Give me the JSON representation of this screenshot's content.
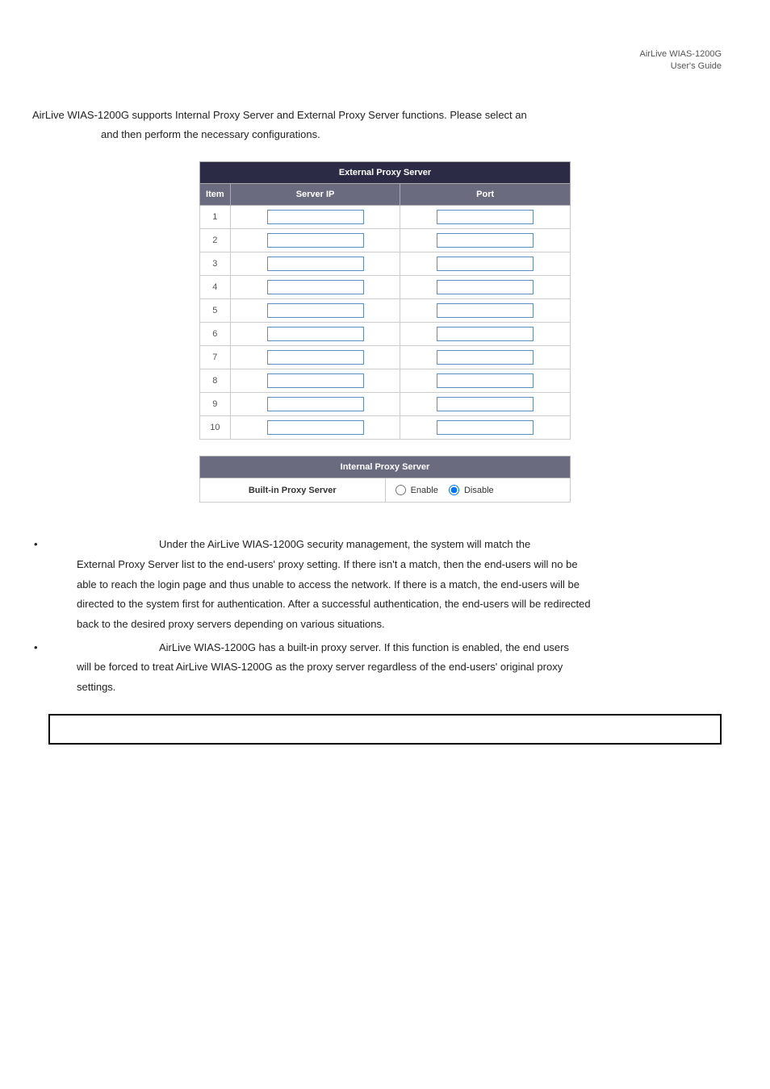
{
  "header": {
    "line1": "AirLive WIAS-1200G",
    "line2": "User's Guide"
  },
  "intro": {
    "line1": "AirLive WIAS-1200G supports Internal Proxy Server and External Proxy Server functions. Please select an",
    "line2": "and then perform the necessary configurations."
  },
  "ext_table": {
    "title": "External Proxy Server",
    "col_item": "Item",
    "col_serverip": "Server IP",
    "col_port": "Port",
    "rows": [
      "1",
      "2",
      "3",
      "4",
      "5",
      "6",
      "7",
      "8",
      "9",
      "10"
    ]
  },
  "int_table": {
    "title": "Internal Proxy Server",
    "label": "Built-in Proxy Server",
    "enable": "Enable",
    "disable": "Disable"
  },
  "bullet1": {
    "l1": "Under the AirLive WIAS-1200G security management, the system will match the",
    "l2": "External Proxy Server list to the end-users' proxy setting. If there isn't a match, then the end-users will no be",
    "l3": "able to reach the login page and thus unable to access the network. If there is a match, the end-users will be",
    "l4": "directed to the system first for authentication. After a successful authentication, the end-users will be redirected",
    "l5": "back to the desired proxy servers depending on various situations."
  },
  "bullet2": {
    "l1": "AirLive WIAS-1200G has a built-in proxy server. If this function is enabled, the end users",
    "l2": "will be forced to treat AirLive WIAS-1200G as the proxy server regardless of the end-users' original proxy",
    "l3": "settings."
  }
}
